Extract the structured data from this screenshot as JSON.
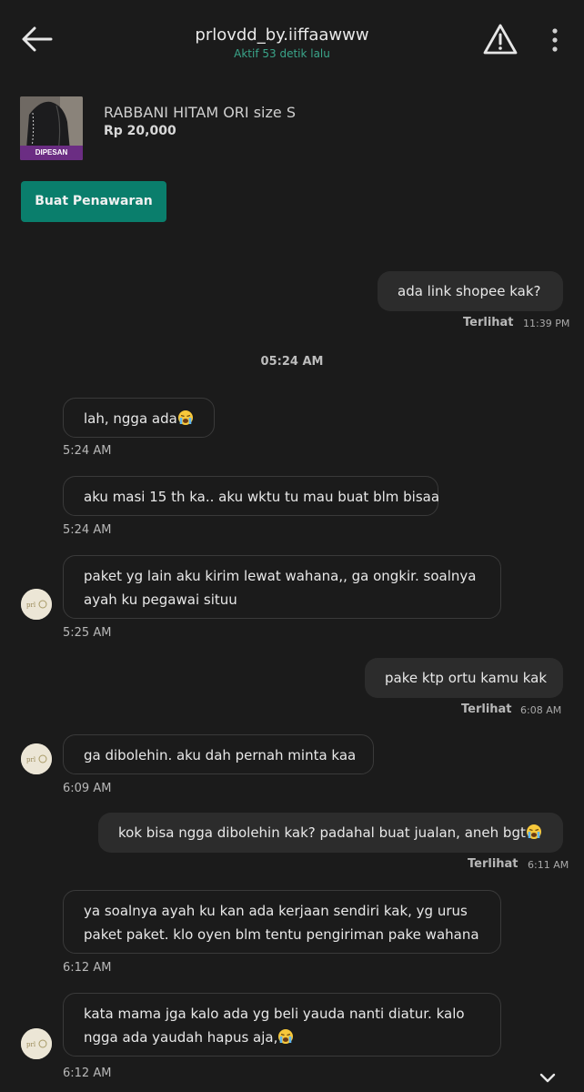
{
  "header": {
    "title": "prlovdd_by.iiffaawww",
    "status": "Aktif 53 detik lalu",
    "back_icon": "back-arrow-icon",
    "warning_icon": "warning-icon",
    "more_icon": "more-vertical-icon"
  },
  "product": {
    "name": "RABBANI HITAM ORI size S",
    "price": "Rp 20,000",
    "badge": "DIPESAN"
  },
  "offer_button": "Buat Penawaran",
  "messages": {
    "m1": {
      "text": "ada link shopee kak?",
      "seen": "Terlihat",
      "time": "11:39 PM"
    },
    "divider": "05:24 AM",
    "m2": {
      "text": "lah, ngga ada",
      "time": "5:24 AM"
    },
    "m3": {
      "text": "aku masi 15 th ka.. aku wktu tu mau buat blm bisaa",
      "time": "5:24 AM"
    },
    "m4": {
      "line1": "paket yg lain aku kirim lewat wahana,, ga ongkir. soalnya",
      "line2": "ayah ku pegawai situu",
      "time": "5:25 AM"
    },
    "m5": {
      "text": "pake ktp ortu kamu kak",
      "seen": "Terlihat",
      "time": "6:08 AM"
    },
    "m6": {
      "text": "ga dibolehin. aku dah pernah minta kaa",
      "time": "6:09 AM"
    },
    "m7": {
      "text": "kok bisa ngga dibolehin kak? padahal buat jualan, aneh bgt",
      "seen": "Terlihat",
      "time": "6:11 AM"
    },
    "m8": {
      "line1": "ya soalnya ayah ku kan ada kerjaan sendiri kak, yg urus",
      "line2": "paket paket. klo oyen blm tentu pengiriman pake wahana",
      "time": "6:12 AM"
    },
    "m9": {
      "line1": "kata mama jga kalo ada yg beli yauda nanti diatur. kalo",
      "line2": "ngga ada yaudah hapus aja,",
      "time": "6:12 AM"
    }
  },
  "emoji_icon": "crying-face-icon",
  "scroll_icon": "chevron-down-icon",
  "colors": {
    "background": "#1b1b1b",
    "accent_green": "#0a7e6c",
    "status_green": "#3aa58a",
    "badge_purple": "#6b2d83",
    "outgoing_bubble": "#2c2c2c"
  }
}
